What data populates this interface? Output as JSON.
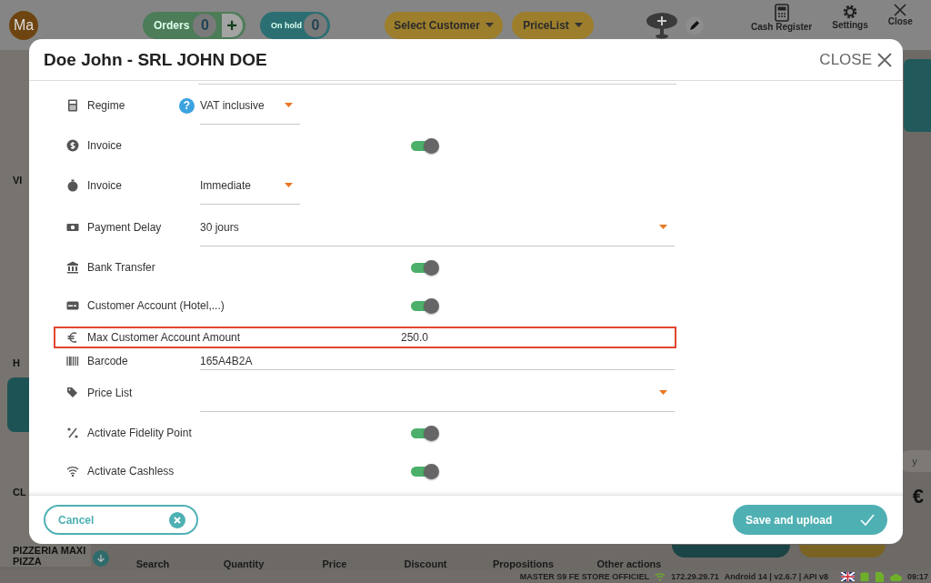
{
  "topbar": {
    "avatar": "Ma",
    "orders": {
      "label": "Orders",
      "count": "0",
      "add": "+"
    },
    "on_hold": {
      "label": "On hold",
      "count": "0"
    },
    "select_customer": "Select Customer",
    "price_list": "PriceList",
    "actions": [
      "Cash Register",
      "Settings",
      "Close"
    ]
  },
  "sidebar": {
    "items": [
      "VI",
      "H",
      "CL",
      "PIZZERIA MAXI PIZZA"
    ]
  },
  "right_panel": {
    "chip": "y",
    "currency": "€"
  },
  "toolbar": [
    "Search",
    "Quantity",
    "Price",
    "Discount",
    "Propositions",
    "Other actions"
  ],
  "status_bar": {
    "store": "MASTER S9 FE STORE OFFICIEL",
    "ip": "172.29.29.71",
    "system": "Android 14  |  v2.6.7 | API v8",
    "time": "09:17"
  },
  "dialog": {
    "title": "Doe John - SRL JOHN DOE",
    "close": "CLOSE",
    "rows": [
      {
        "kind": "short-select",
        "label": "Regime",
        "help": "?",
        "value": "VAT inclusive"
      },
      {
        "kind": "toggle",
        "label": "Invoice",
        "on": true
      },
      {
        "kind": "short-select",
        "label": "Invoice",
        "value": "Immediate"
      },
      {
        "kind": "select",
        "label": "Payment Delay",
        "value": "30 jours"
      },
      {
        "kind": "toggle",
        "label": "Bank Transfer",
        "on": true
      },
      {
        "kind": "toggle",
        "label": "Customer Account (Hotel,...)",
        "on": true
      },
      {
        "kind": "amount",
        "label": "Max Customer Account Amount",
        "value": "250.0",
        "highlighted": true
      },
      {
        "kind": "text",
        "label": "Barcode",
        "value": "165A4B2A"
      },
      {
        "kind": "select",
        "label": "Price List"
      },
      {
        "kind": "toggle",
        "label": "Activate Fidelity Point",
        "on": true
      },
      {
        "kind": "toggle",
        "label": "Activate Cashless",
        "on": true
      }
    ],
    "cancel": "Cancel",
    "save": "Save and upload"
  }
}
